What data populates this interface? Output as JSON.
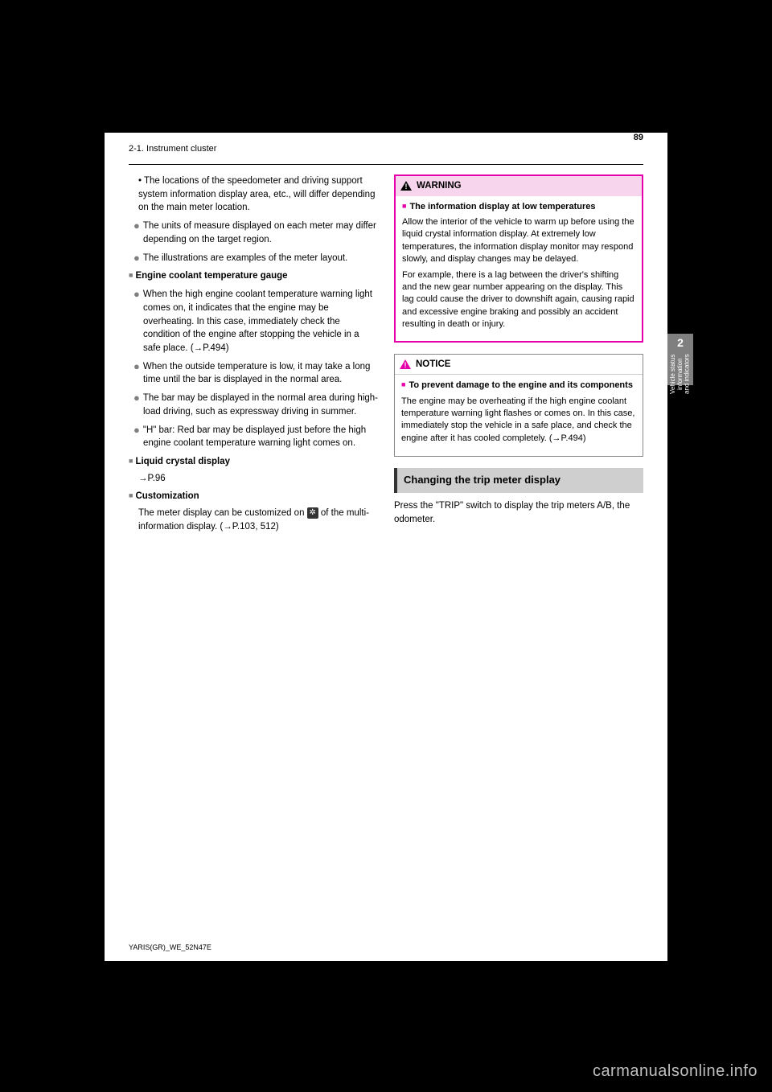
{
  "header": {
    "section": "2-1. Instrument cluster",
    "page_number": "89"
  },
  "tab": {
    "number": "2",
    "label": "Vehicle status information and indicators"
  },
  "left_column": {
    "intro": "• The locations of the speedometer and driving support system information display area, etc., will differ depending on the main meter location.",
    "bullets_top": [
      "The units of measure displayed on each meter may differ depending on the target region.",
      "The illustrations are examples of the meter layout."
    ],
    "sub1_title": "Engine coolant temperature gauge",
    "sub1_body": "When the high engine coolant temperature warning light comes on, it indicates that the engine may be overheating. In this case, immediately check the condition of the engine after stopping the vehicle in a safe place. (→P.494)",
    "sub1_bullets": [
      "When the outside temperature is low, it may take a long time until the bar is displayed in the normal area.",
      "The bar may be displayed in the normal area during high-load driving, such as expressway driving in summer.",
      "\"H\" bar: Red bar may be displayed just before the high engine coolant temperature warning light comes on."
    ],
    "sub2_title": "Liquid crystal display",
    "sub2_body": "→P.96",
    "sub3_title": "Customization",
    "sub3_body_pre": "The meter display can be customized on ",
    "sub3_body_post": " of the multi-information display. (→P.103, 512)"
  },
  "right_column": {
    "warning_label": "WARNING",
    "warning_item_title": "The information display at low temperatures",
    "warning_item_body": "Allow the interior of the vehicle to warm up before using the liquid crystal information display. At extremely low temperatures, the information display monitor may respond slowly, and display changes may be delayed.",
    "warning_item_body2": "For example, there is a lag between the driver's shifting and the new gear number appearing on the display. This lag could cause the driver to downshift again, causing rapid and excessive engine braking and possibly an accident resulting in death or injury.",
    "notice_label": "NOTICE",
    "notice_item_title": "To prevent damage to the engine and its components",
    "notice_item_body": "The engine may be overheating if the high engine coolant temperature warning light flashes or comes on. In this case, immediately stop the vehicle in a safe place, and check the engine after it has cooled completely. (→P.494)",
    "section_title": "Changing the trip meter display",
    "section_body": "Press the \"TRIP\" switch to display the trip meters A/B, the odometer."
  },
  "footer": {
    "doc_code": "YARIS(GR)_WE_52N47E",
    "watermark": "carmanualsonline.info"
  }
}
